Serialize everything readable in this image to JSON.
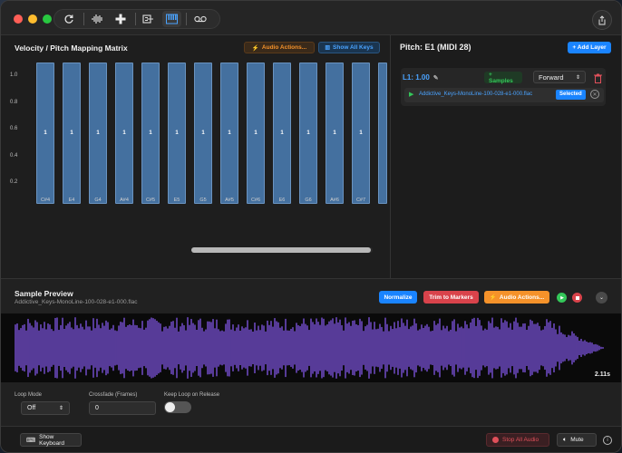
{
  "toolbar": {
    "icons": [
      "refresh-icon",
      "waveform-icon",
      "add-icon",
      "export-icon",
      "piano-icon",
      "tape-icon"
    ]
  },
  "matrix": {
    "title": "Velocity / Pitch Mapping Matrix",
    "audio_actions_label": "Audio Actions...",
    "show_all_keys_label": "Show All Keys",
    "y_ticks": [
      "1.0",
      "0.8",
      "0.6",
      "0.4",
      "0.2"
    ],
    "columns": [
      {
        "note": "C#4",
        "value": "1"
      },
      {
        "note": "E4",
        "value": "1"
      },
      {
        "note": "G4",
        "value": "1"
      },
      {
        "note": "A#4",
        "value": "1"
      },
      {
        "note": "C#5",
        "value": "1"
      },
      {
        "note": "E5",
        "value": "1"
      },
      {
        "note": "G5",
        "value": "1"
      },
      {
        "note": "A#5",
        "value": "1"
      },
      {
        "note": "C#6",
        "value": "1"
      },
      {
        "note": "E6",
        "value": "1"
      },
      {
        "note": "G6",
        "value": "1"
      },
      {
        "note": "A#6",
        "value": "1"
      },
      {
        "note": "C#7",
        "value": "1"
      },
      {
        "note": "",
        "value": ""
      }
    ]
  },
  "pitch": {
    "title": "Pitch: E1 (MIDI 28)",
    "add_layer_label": "+ Add Layer",
    "layer_label": "L1: 1.00",
    "samples_label": "+ Samples",
    "direction_value": "Forward",
    "sample_name": "Addictive_Keys-MonoLine-100-028-e1-000.flac",
    "selected_badge": "Selected"
  },
  "preview": {
    "title": "Sample Preview",
    "filename": "Addictive_Keys-MonoLine-100-028-e1-000.flac",
    "normalize_label": "Normalize",
    "trim_label": "Trim to Markers",
    "audio_actions_label": "Audio Actions...",
    "duration": "2.11s",
    "loop_mode_label": "Loop Mode",
    "loop_mode_value": "Off",
    "crossfade_label": "Crossfade (Frames)",
    "crossfade_value": "0",
    "keep_loop_label": "Keep Loop on Release"
  },
  "footer": {
    "show_keyboard_label": "Show Keyboard",
    "stop_all_label": "Stop All Audio",
    "mute_label": "Mute"
  },
  "colors": {
    "accent_blue": "#1a84ff",
    "column_fill": "#44709f",
    "waveform": "#8a5cf6",
    "orange": "#f5922a",
    "red": "#d9434b",
    "green": "#34c759"
  }
}
